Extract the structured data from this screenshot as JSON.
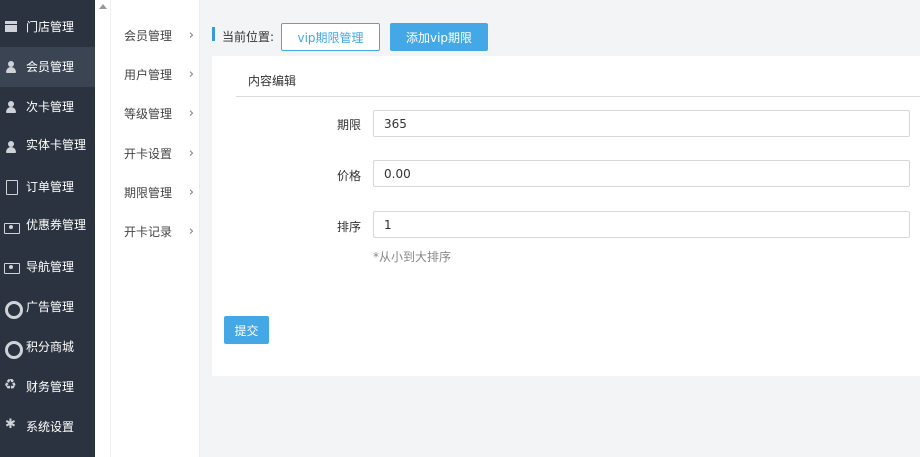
{
  "sidebar": {
    "items": [
      {
        "label": "门店管理",
        "icon": "bank-icon"
      },
      {
        "label": "会员管理",
        "icon": "user-icon"
      },
      {
        "label": "次卡管理",
        "icon": "user-icon"
      },
      {
        "label": "实体卡管理",
        "icon": "user-icon"
      },
      {
        "label": "订单管理",
        "icon": "document-icon"
      },
      {
        "label": "优惠券管理",
        "icon": "money-icon"
      },
      {
        "label": "导航管理",
        "icon": "money-icon"
      },
      {
        "label": "广告管理",
        "icon": "lifebuoy-icon"
      },
      {
        "label": "积分商城",
        "icon": "lifebuoy-icon"
      },
      {
        "label": "财务管理",
        "icon": "recycle-icon"
      },
      {
        "label": "系统设置",
        "icon": "gear-icon"
      }
    ]
  },
  "submenu": {
    "items": [
      {
        "label": "会员管理"
      },
      {
        "label": "用户管理"
      },
      {
        "label": "等级管理"
      },
      {
        "label": "开卡设置"
      },
      {
        "label": "期限管理"
      },
      {
        "label": "开卡记录"
      }
    ]
  },
  "breadcrumb": {
    "label": "当前位置:",
    "link_button": "vip期限管理",
    "add_button": "添加vip期限"
  },
  "panel": {
    "tab": "内容编辑",
    "fields": {
      "period": {
        "label": "期限",
        "value": "365"
      },
      "price": {
        "label": "价格",
        "value": "0.00"
      },
      "order": {
        "label": "排序",
        "value": "1"
      }
    },
    "hint": "*从小到大排序",
    "submit": "提交"
  },
  "colors": {
    "sidebar_bg": "#2b3340",
    "accent": "#45a8e6"
  }
}
